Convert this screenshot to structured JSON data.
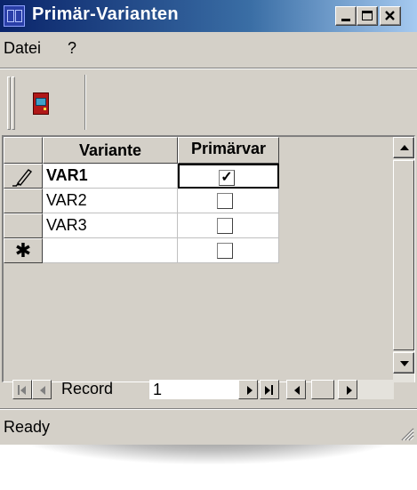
{
  "window": {
    "title": "Primär-Varianten",
    "controls": {
      "minimize": "minimize-button",
      "maximize": "maximize-button",
      "close": "close-button"
    }
  },
  "menu": {
    "items": [
      {
        "label": "Datei"
      },
      {
        "label": "?"
      }
    ]
  },
  "toolbar": {
    "buttons": [
      {
        "icon": "exit-door-icon"
      }
    ]
  },
  "grid": {
    "columns": [
      {
        "label": "Variante"
      },
      {
        "label": "Primärvar"
      }
    ],
    "rows": [
      {
        "selector_icon": "pencil-icon",
        "variante": "VAR1",
        "primaer": true,
        "bold": true
      },
      {
        "selector_icon": "",
        "variante": "VAR2",
        "primaer": false,
        "bold": false
      },
      {
        "selector_icon": "",
        "variante": "VAR3",
        "primaer": false,
        "bold": false
      },
      {
        "selector_icon": "asterisk-icon",
        "new_record_marker": "✱",
        "variante": "",
        "primaer": false,
        "bold": false
      }
    ],
    "check_mark": "✓"
  },
  "navigation": {
    "label": "Record",
    "current": "1"
  },
  "status": {
    "text": "Ready"
  }
}
